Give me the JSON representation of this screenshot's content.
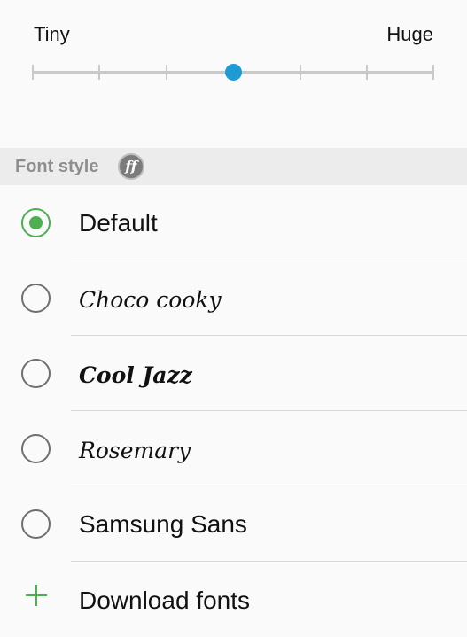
{
  "font_size": {
    "min_label": "Tiny",
    "max_label": "Huge",
    "steps": 7,
    "selected_step": 3,
    "accent_color": "#1f9bd3"
  },
  "font_style": {
    "section_title": "Font style",
    "section_icon": "ff-icon",
    "selected_color": "#4caf50",
    "options": [
      {
        "label": "Default",
        "selected": true
      },
      {
        "label": "Choco cooky",
        "selected": false
      },
      {
        "label": "Cool Jazz",
        "selected": false
      },
      {
        "label": "Rosemary",
        "selected": false
      },
      {
        "label": "Samsung Sans",
        "selected": false
      }
    ],
    "download": {
      "label": "Download fonts",
      "icon": "plus-icon"
    }
  }
}
